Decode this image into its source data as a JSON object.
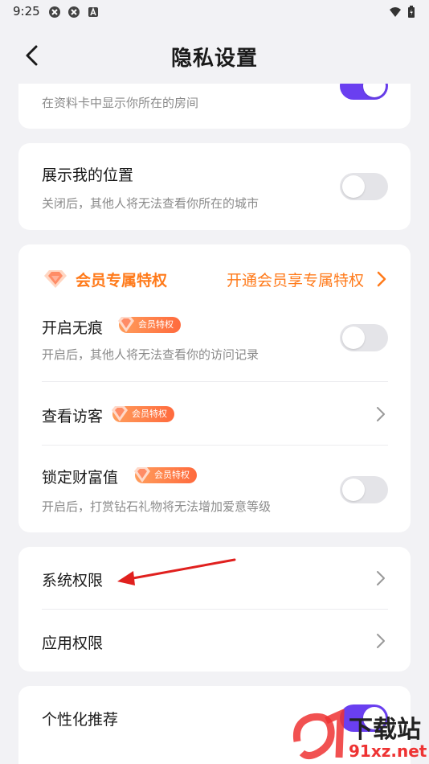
{
  "status_bar": {
    "time": "9:25"
  },
  "header": {
    "title": "隐私设置"
  },
  "partial_card": {
    "subtitle": "在资料卡中显示你所在的房间",
    "toggle_on": true
  },
  "location_card": {
    "title": "展示我的位置",
    "subtitle": "关闭后，其他人将无法查看你所在的城市",
    "toggle_on": false
  },
  "vip_card": {
    "header_label": "会员专属特权",
    "header_link": "开通会员享专属特权",
    "badge_label": "会员特权",
    "items": [
      {
        "title": "开启无痕",
        "subtitle": "开启后，其他人将无法查看你的访问记录",
        "control": "toggle",
        "toggle_on": false
      },
      {
        "title": "查看访客",
        "control": "chevron"
      },
      {
        "title": "锁定财富值",
        "subtitle": "开启后，打赏钻石礼物将无法增加爱意等级",
        "control": "toggle",
        "toggle_on": false
      }
    ]
  },
  "permissions_card": {
    "items": [
      {
        "title": "系统权限"
      },
      {
        "title": "应用权限"
      }
    ]
  },
  "recommend_card": {
    "title": "个性化推荐",
    "toggle_on": true
  },
  "watermark": {
    "text": "下载站",
    "site": "91xz.net"
  },
  "colors": {
    "accent_purple": "#6a3ff0",
    "vip_orange": "#ff7a1a",
    "annotation_red": "#e0201e"
  }
}
